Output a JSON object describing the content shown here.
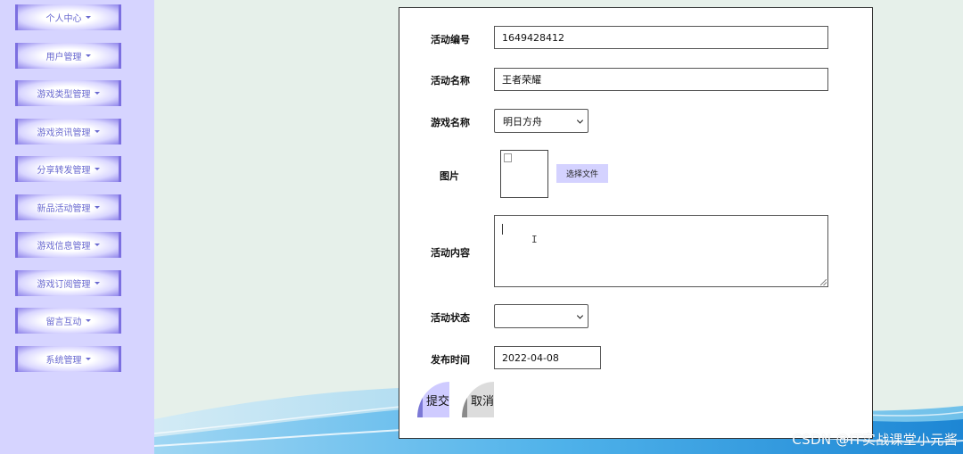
{
  "sidebar": {
    "items": [
      {
        "label": "个人中心"
      },
      {
        "label": "用户管理"
      },
      {
        "label": "游戏类型管理"
      },
      {
        "label": "游戏资讯管理"
      },
      {
        "label": "分享转发管理"
      },
      {
        "label": "新品活动管理"
      },
      {
        "label": "游戏信息管理"
      },
      {
        "label": "游戏订阅管理"
      },
      {
        "label": "留言互动"
      },
      {
        "label": "系统管理"
      }
    ]
  },
  "form": {
    "activity_id": {
      "label": "活动编号",
      "value": "1649428412"
    },
    "activity_name": {
      "label": "活动名称",
      "value": "王者荣耀"
    },
    "game_name": {
      "label": "游戏名称",
      "selected": "明日方舟"
    },
    "image": {
      "label": "图片",
      "choose_file_label": "选择文件"
    },
    "content": {
      "label": "活动内容",
      "value": ""
    },
    "status": {
      "label": "活动状态",
      "selected": ""
    },
    "publish_time": {
      "label": "发布时间",
      "value": "2022-04-08"
    },
    "submit_label": "提交",
    "cancel_label": "取消"
  },
  "colors": {
    "sidebar_bg": "#d6d4ff",
    "menu_border": "#7c6fe0",
    "page_bg": "#e6f0ea",
    "wave_blue": "#1e90d8"
  },
  "watermark": "CSDN @IT实战课堂小元酱"
}
